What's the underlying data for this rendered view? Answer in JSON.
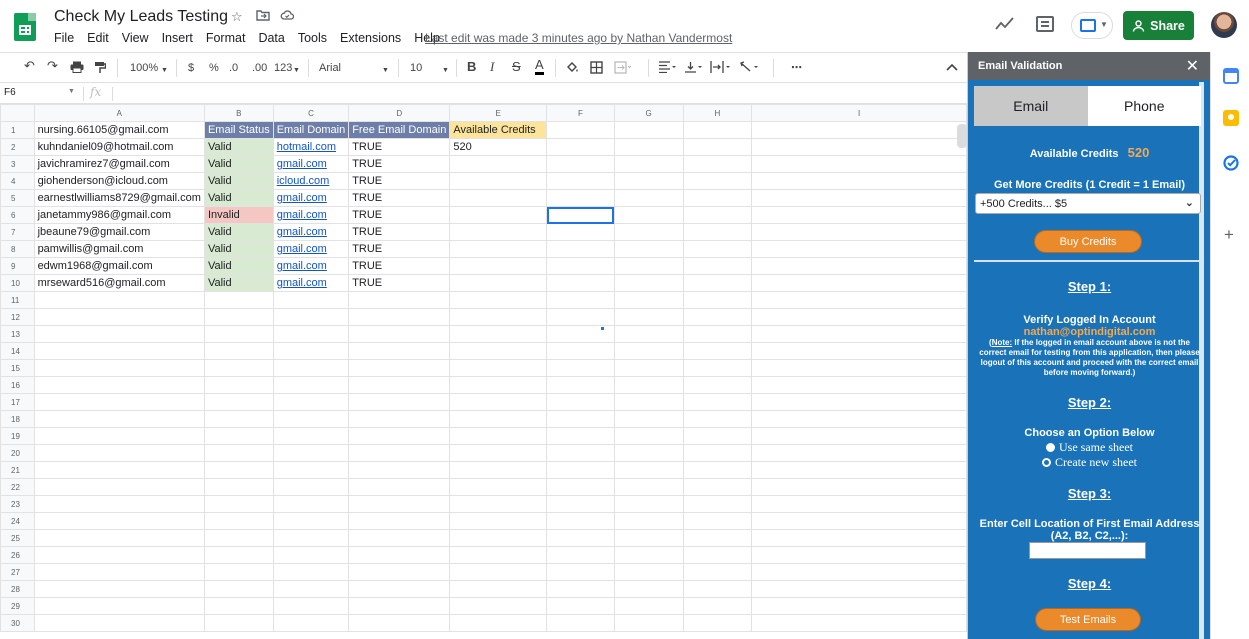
{
  "header": {
    "doc_title": "Check My Leads Testing",
    "menus": [
      "File",
      "Edit",
      "View",
      "Insert",
      "Format",
      "Data",
      "Tools",
      "Extensions",
      "Help"
    ],
    "last_edit": "Last edit was made 3 minutes ago by Nathan Vandermost",
    "share_label": "Share",
    "icons": [
      "star-icon",
      "move-folder-icon",
      "cloud-status-icon",
      "trend-icon",
      "comment-icon",
      "present-icon"
    ]
  },
  "toolbar": {
    "zoom": "100%",
    "currency": "$",
    "percent": "%",
    "decrease_decimal": ".0",
    "increase_decimal": ".00",
    "more_formats": "123",
    "font": "Arial",
    "font_size": "10",
    "bold": "B",
    "italic": "I",
    "strike": "S",
    "text_color": "A",
    "more": "⋯"
  },
  "formula_bar": {
    "name_box": "F6",
    "fx": "fx",
    "value": ""
  },
  "sheet": {
    "columns": [
      "A",
      "B",
      "C",
      "D",
      "E",
      "F",
      "G",
      "H",
      "I"
    ],
    "row_numbers": [
      "1",
      "2",
      "3",
      "4",
      "5",
      "6",
      "7",
      "8",
      "9",
      "10",
      "11",
      "12",
      "13",
      "14",
      "15",
      "16",
      "17",
      "18",
      "19",
      "20",
      "21",
      "22",
      "23",
      "24",
      "25",
      "26",
      "27",
      "28",
      "29",
      "30"
    ],
    "header_row": {
      "a": "nursing.66105@gmail.com",
      "b": "Email Status",
      "c": "Email Domain",
      "d": "Free Email Domain",
      "e": "Available Credits"
    },
    "data_rows": [
      {
        "a": "kuhndaniel09@hotmail.com",
        "b": "Valid",
        "c": "hotmail.com",
        "d": "TRUE",
        "e": "520"
      },
      {
        "a": "javichramirez7@gmail.com",
        "b": "Valid",
        "c": "gmail.com",
        "d": "TRUE",
        "e": ""
      },
      {
        "a": "giohenderson@icloud.com",
        "b": "Valid",
        "c": "icloud.com",
        "d": "TRUE",
        "e": ""
      },
      {
        "a": "earnestlwilliams8729@gmail.com",
        "b": "Valid",
        "c": "gmail.com",
        "d": "TRUE",
        "e": ""
      },
      {
        "a": "janetammy986@gmail.com",
        "b": "Invalid",
        "c": "gmail.com",
        "d": "TRUE",
        "e": ""
      },
      {
        "a": "jbeaune79@gmail.com",
        "b": "Valid",
        "c": "gmail.com",
        "d": "TRUE",
        "e": ""
      },
      {
        "a": "pamwillis@gmail.com",
        "b": "Valid",
        "c": "gmail.com",
        "d": "TRUE",
        "e": ""
      },
      {
        "a": "edwm1968@gmail.com",
        "b": "Valid",
        "c": "gmail.com",
        "d": "TRUE",
        "e": ""
      },
      {
        "a": "mrseward516@gmail.com",
        "b": "Valid",
        "c": "gmail.com",
        "d": "TRUE",
        "e": ""
      }
    ],
    "selected_cell": "F6",
    "colors": {
      "header_bg": "#6d7ea8",
      "credits_bg": "#fde49b",
      "valid_bg": "#d9ead3",
      "invalid_bg": "#f4c7c3",
      "link": "#1155cc"
    }
  },
  "panel": {
    "title": "Email Validation",
    "close": "✕",
    "tabs": [
      "Email",
      "Phone"
    ],
    "available_credits_label": "Available Credits",
    "available_credits_value": "520",
    "get_more_label": "Get More Credits (1 Credit = 1 Email)",
    "credits_option": "+500 Credits... $5",
    "buy_label": "Buy Credits",
    "step1": "Step 1:",
    "verify_label": "Verify Logged In Account",
    "account_email": "nathan@optindigital.com",
    "note_prefix": "Note:",
    "note_text": " If the logged in email account above is not the correct email for testing from this application, then please logout of this account and proceed with the correct email before moving forward.)",
    "step2": "Step 2:",
    "choose_label": "Choose an Option Below",
    "option_same": "Use same sheet",
    "option_new": "Create new sheet",
    "step3": "Step 3:",
    "cell_location_label": "Enter Cell Location of First Email Address",
    "cell_location_hint": "(A2, B2, C2,...):",
    "cell_input_value": "",
    "step4": "Step 4:",
    "test_label": "Test Emails",
    "colors": {
      "bg": "#1a73b8",
      "accent": "#f5a94d",
      "button": "#ea8a2a"
    }
  },
  "rail": {
    "icons": [
      "calendar-icon",
      "keep-icon",
      "tasks-icon",
      "add-icon"
    ],
    "add": "+"
  }
}
